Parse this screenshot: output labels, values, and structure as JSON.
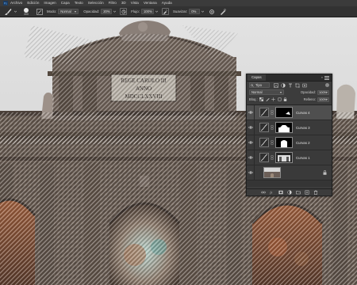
{
  "menubar": {
    "items": [
      "Archivo",
      "Edición",
      "Imagen",
      "Capa",
      "Texto",
      "Selección",
      "Filtro",
      "3D",
      "Vista",
      "Ventana",
      "Ayuda"
    ]
  },
  "options": {
    "brush_size": "300",
    "mode_label": "Modo:",
    "mode_value": "Normal",
    "opacity_label": "Opacidad:",
    "opacity_value": "20%",
    "flow_label": "Flujo:",
    "flow_value": "100%",
    "smoothing_label": "Suavizar:",
    "smoothing_value": "0%"
  },
  "layers_panel": {
    "tab_label": "Capas",
    "filter_label": "Tipo",
    "blend_mode": "Normal",
    "opacity_label": "Opacidad:",
    "opacity_value": "100%",
    "lock_label": "Bloq.:",
    "fill_label": "Relleno:",
    "fill_value": "100%",
    "layers": [
      {
        "name": "Curvas 4",
        "selected": true,
        "visible": true
      },
      {
        "name": "Curvas 3",
        "selected": false,
        "visible": true
      },
      {
        "name": "Curvas 2",
        "selected": false,
        "visible": true
      },
      {
        "name": "Curvas 1",
        "selected": false,
        "visible": true
      },
      {
        "name": "",
        "selected": false,
        "visible": true,
        "background": true
      }
    ]
  },
  "canvas": {
    "inscription_lines": [
      "REGE CAROLO III",
      "ANNO",
      "MDCCLXXVIII"
    ]
  },
  "colors": {
    "ui_dark": "#2b2b2b",
    "panel": "#3c3c3c",
    "selected_row": "#4f4f4f",
    "stone": "#6b5e57",
    "sky": "#dcdcdc"
  }
}
